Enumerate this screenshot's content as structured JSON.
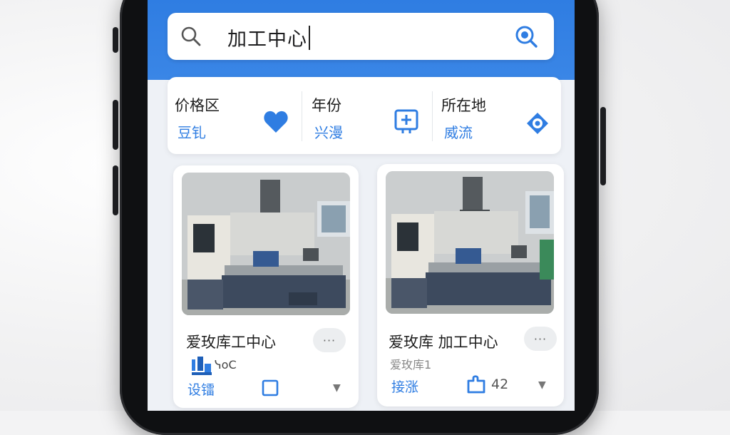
{
  "search": {
    "query": "加工中心"
  },
  "filters": [
    {
      "title": "价格区",
      "value": "豆钆",
      "icon": "heart-icon"
    },
    {
      "title": "年份",
      "value": "兴漫",
      "icon": "calendar-plus-icon"
    },
    {
      "title": "所在地",
      "value": "威流",
      "icon": "location-target-icon"
    }
  ],
  "products": [
    {
      "title": "爱玫库工中心",
      "brand_text": "ᓭoC",
      "action": "设镭",
      "more": "···"
    },
    {
      "title": "爱玫库  加工中心",
      "subtitle": "爱玫库1",
      "action": "接涨",
      "count": "42",
      "more": "···"
    }
  ],
  "colors": {
    "accent": "#2f7de2",
    "header": "#3a86e6"
  }
}
